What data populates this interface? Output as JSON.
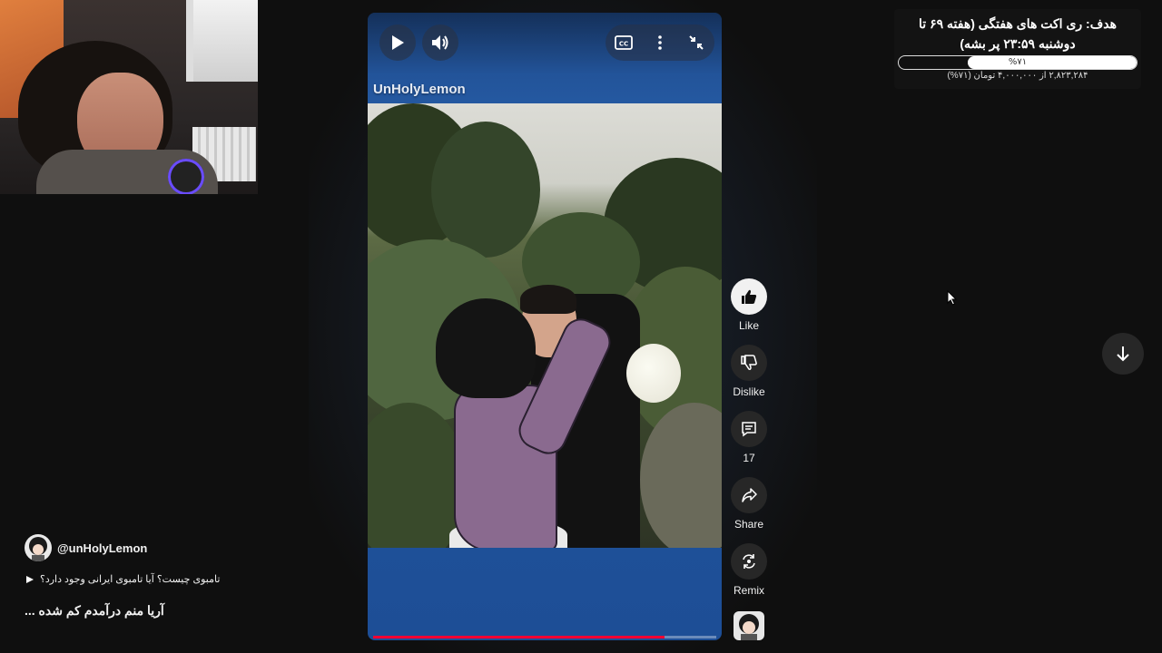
{
  "webcam": {},
  "goal": {
    "title": "هدف: ری اکت های هفتگی (هفته ۶۹ تا دوشنبه ۲۳:۵۹ پر بشه)",
    "percent_label": "%۷۱",
    "progress": 0.71,
    "amount": "۲,۸۲۳,۲۸۴ از ۴,۰۰۰,۰۰۰ تومان (۷۱%)"
  },
  "video": {
    "channel_tag": "UnHolyLemon",
    "progress": 0.85,
    "controls": {
      "play_icon": "play-icon",
      "volume_icon": "volume-icon",
      "captions_icon": "captions-icon",
      "more_icon": "more-vert-icon",
      "collapse_icon": "collapse-icon"
    }
  },
  "actions": {
    "like": "Like",
    "dislike": "Dislike",
    "comments": "17",
    "share": "Share",
    "remix": "Remix"
  },
  "channel": {
    "handle": "@unHolyLemon"
  },
  "playlist": {
    "title": "تامبوی چیست؟ آیا تامبوی ایرانی وجود دارد؟"
  },
  "description": "آریا منم درآمدم کم شده ...",
  "colors": {
    "background": "#0f0f0f",
    "progress": "#ff0033",
    "video_blue": "#2458a0",
    "button": "#272727"
  }
}
